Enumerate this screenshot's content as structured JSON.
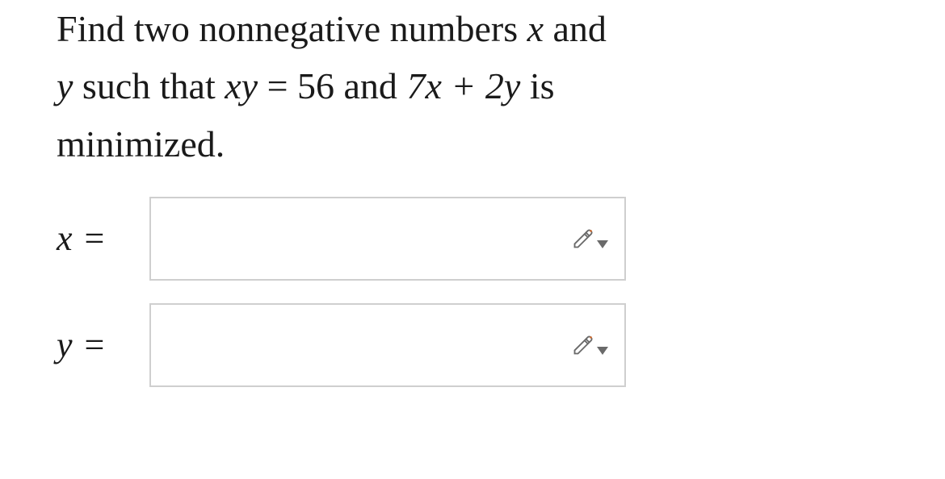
{
  "problem": {
    "line1_pre": "Find two nonnegative numbers ",
    "line1_var": "x",
    "line1_post": " and",
    "line2_var1": "y",
    "line2_txt1": " such that ",
    "line2_mathA": "xy",
    "line2_eq": " = ",
    "line2_num": "56",
    "line2_and": " and ",
    "line2_mathB": "7x + 2y",
    "line2_is": " is",
    "line3": "minimized."
  },
  "answers": [
    {
      "label_var": "x",
      "label_eq": " =",
      "value": ""
    },
    {
      "label_var": "y",
      "label_eq": " =",
      "value": ""
    }
  ]
}
